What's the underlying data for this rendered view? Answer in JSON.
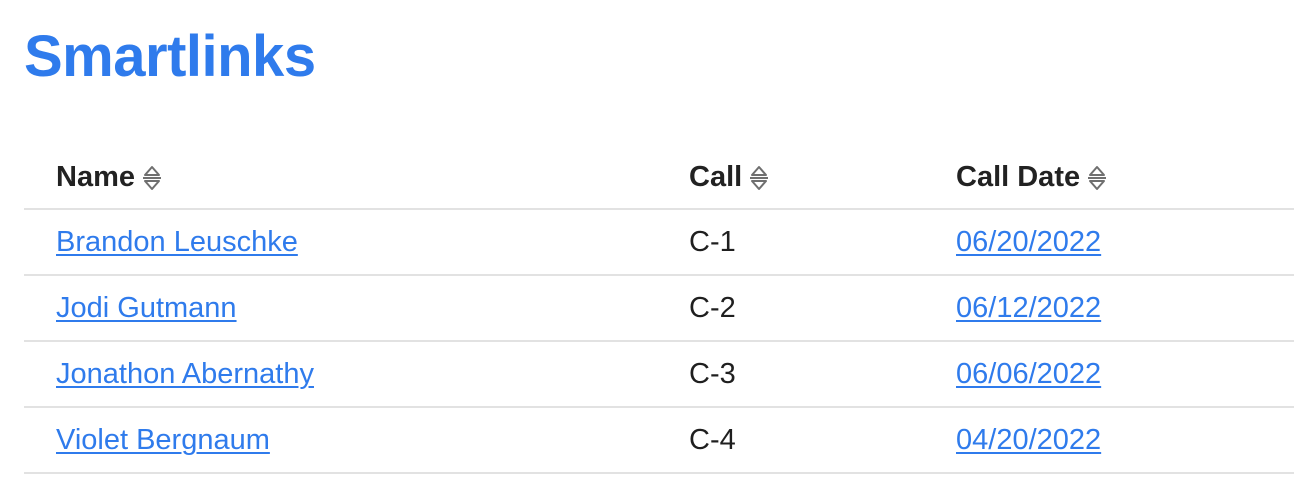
{
  "page": {
    "title": "Smartlinks"
  },
  "table": {
    "columns": [
      {
        "label": "Name",
        "sort_icon": "sort-updown-icon"
      },
      {
        "label": "Call",
        "sort_icon": "sort-updown-icon"
      },
      {
        "label": "Call Date",
        "sort_icon": "sort-updown-icon"
      }
    ],
    "rows": [
      {
        "name": "Brandon Leuschke",
        "call": "C-1",
        "call_date": "06/20/2022"
      },
      {
        "name": "Jodi Gutmann",
        "call": "C-2",
        "call_date": "06/12/2022"
      },
      {
        "name": "Jonathon Abernathy",
        "call": "C-3",
        "call_date": "06/06/2022"
      },
      {
        "name": "Violet Bergnaum",
        "call": "C-4",
        "call_date": "04/20/2022"
      }
    ]
  },
  "colors": {
    "accent": "#2f7bec",
    "text": "#1f1f1f",
    "divider": "#e2e2e2",
    "icon": "#6f6f6f"
  }
}
